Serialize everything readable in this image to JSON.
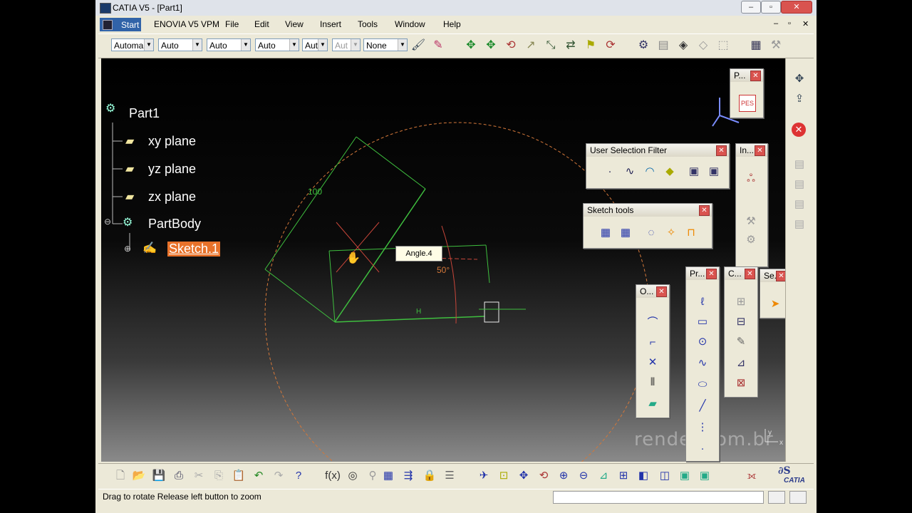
{
  "window": {
    "title": "CATIA V5 - [Part1]"
  },
  "menu": {
    "start": "Start",
    "items": [
      "ENOVIA V5 VPM",
      "File",
      "Edit",
      "View",
      "Insert",
      "Tools",
      "Window",
      "Help"
    ]
  },
  "toolbar": {
    "combos": [
      "Automa",
      "Auto",
      "Auto",
      "Auto",
      "Aut",
      "Aut",
      "None"
    ]
  },
  "tree": {
    "root": "Part1",
    "items": [
      "xy plane",
      "yz plane",
      "zx plane",
      "PartBody"
    ],
    "sketch": "Sketch.1"
  },
  "sketch": {
    "dim_length": "100",
    "dim_angle": "50°",
    "tooltip": "Angle.4",
    "h_label": "H"
  },
  "panels": {
    "user_selection_filter": "User Selection Filter",
    "sketch_tools": "Sketch tools",
    "p_small": "P...",
    "in_small": "In...",
    "o_small": "O...",
    "pr_small": "Pr...",
    "c_small": "C...",
    "se_small": "Se...",
    "pdf_label": "PES"
  },
  "status": {
    "text": "Drag to rotate  Release left button to zoom"
  },
  "watermark": "render.com.br",
  "brand": "CATIA",
  "colors": {
    "sketch_green": "#3fbf3f",
    "circle_orange": "#d4783a",
    "selected_bg": "#e8722a",
    "title_bg": "#3163a8"
  }
}
